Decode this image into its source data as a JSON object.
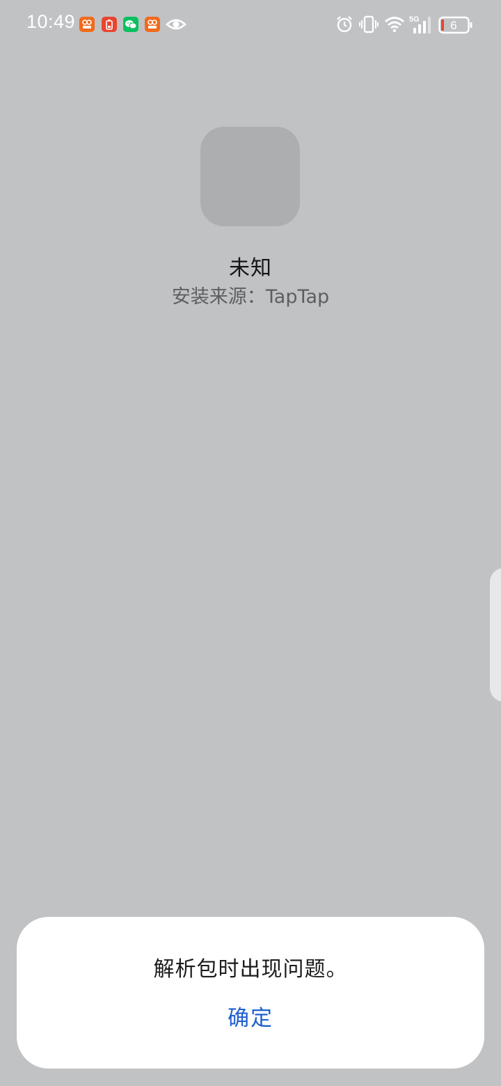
{
  "status_bar": {
    "time": "10:49",
    "notification_icons": [
      "taobao-live-icon",
      "battery-alert-app-icon",
      "wechat-icon",
      "taobao-live-icon",
      "eye-icon"
    ],
    "system_icons": [
      "alarm-icon",
      "vibrate-icon",
      "wifi-icon",
      "signal-5g-icon",
      "battery-icon"
    ],
    "network_type": "5G",
    "battery_level": "6",
    "colors": {
      "taobao": "#f26a1b",
      "red_app": "#e8452f",
      "wechat": "#07c160",
      "battery_low": "#e8452f"
    }
  },
  "app": {
    "name": "未知",
    "install_source": "安装来源：TapTap"
  },
  "dialog": {
    "message": "解析包时出现问题。",
    "confirm_label": "确定",
    "accent_color": "#1f5fcf"
  }
}
